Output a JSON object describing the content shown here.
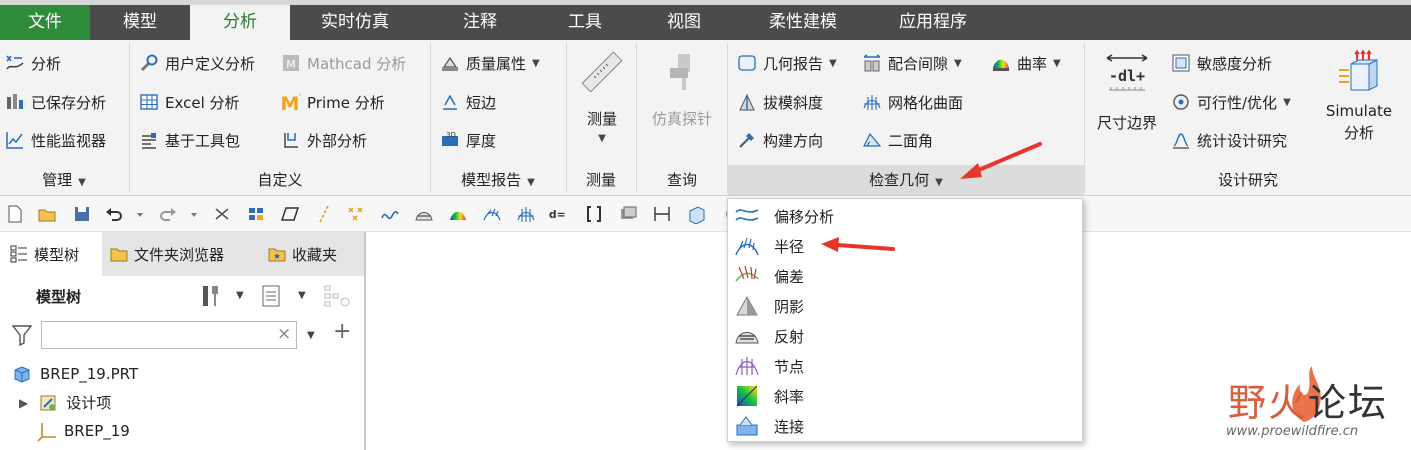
{
  "menu": {
    "tabs": [
      "文件",
      "模型",
      "分析",
      "实时仿真",
      "注释",
      "工具",
      "视图",
      "柔性建模",
      "应用程序"
    ],
    "active_tab": "分析"
  },
  "ribbon": {
    "manage": {
      "items": [
        "分析",
        "已保存分析",
        "性能监视器"
      ],
      "label": "管理"
    },
    "custom": {
      "items": [
        "用户定义分析",
        "Mathcad 分析",
        "Excel 分析",
        "Prime 分析",
        "基于工具包",
        "外部分析"
      ],
      "label": "自定义"
    },
    "model_report": {
      "items": [
        "质量属性",
        "短边",
        "厚度"
      ],
      "label": "模型报告"
    },
    "measure": {
      "button": "测量",
      "label": "测量"
    },
    "query": {
      "button": "仿真探针",
      "label": "查询"
    },
    "inspect": {
      "items": [
        "几何报告",
        "配合间隙",
        "曲率",
        "拔模斜度",
        "网格化曲面",
        "构建方向",
        "二面角"
      ],
      "label": "检查几何"
    },
    "design_study": {
      "dim_boundary": "尺寸边界",
      "items": [
        "敏感度分析",
        "可行性/优化",
        "统计设计研究"
      ],
      "simulate_line1": "Simulate",
      "simulate_line2": "分析",
      "label": "设计研究"
    }
  },
  "panel": {
    "tabs": [
      "模型树",
      "文件夹浏览器",
      "收藏夹"
    ],
    "header": "模型树",
    "filter_value": "",
    "filter_clear": "×",
    "add": "+",
    "tree": {
      "root": "BREP_19.PRT",
      "child": "设计项",
      "csys": "BREP_19"
    }
  },
  "dropdown": {
    "items": [
      "偏移分析",
      "半径",
      "偏差",
      "阴影",
      "反射",
      "节点",
      "斜率",
      "连接"
    ]
  },
  "watermark": {
    "title_a": "野火",
    "title_b": "论坛",
    "url": "www.proewildfire.cn"
  },
  "colors": {
    "tab_bar": "#4b4b4b",
    "file_tab": "#2e8b3a",
    "active_text": "#2a7d36",
    "ribbon_bg": "#f3f3f3",
    "annotation_arrow": "#e8352b"
  },
  "icons": [
    "analysis-icon",
    "saved-analysis-icon",
    "performance-monitor-icon",
    "user-defined-analysis-icon",
    "mathcad-icon",
    "excel-icon",
    "prime-icon",
    "toolkit-icon",
    "external-analysis-icon",
    "mass-properties-icon",
    "short-edge-icon",
    "thickness-icon",
    "ruler-icon",
    "probe-icon",
    "geometry-report-icon",
    "clearance-icon",
    "curvature-icon",
    "draft-icon",
    "mesh-surface-icon",
    "build-direction-icon",
    "dihedral-angle-icon",
    "dimension-boundary-icon",
    "sensitivity-icon",
    "feasibility-icon",
    "statistical-study-icon",
    "simulate-icon"
  ]
}
